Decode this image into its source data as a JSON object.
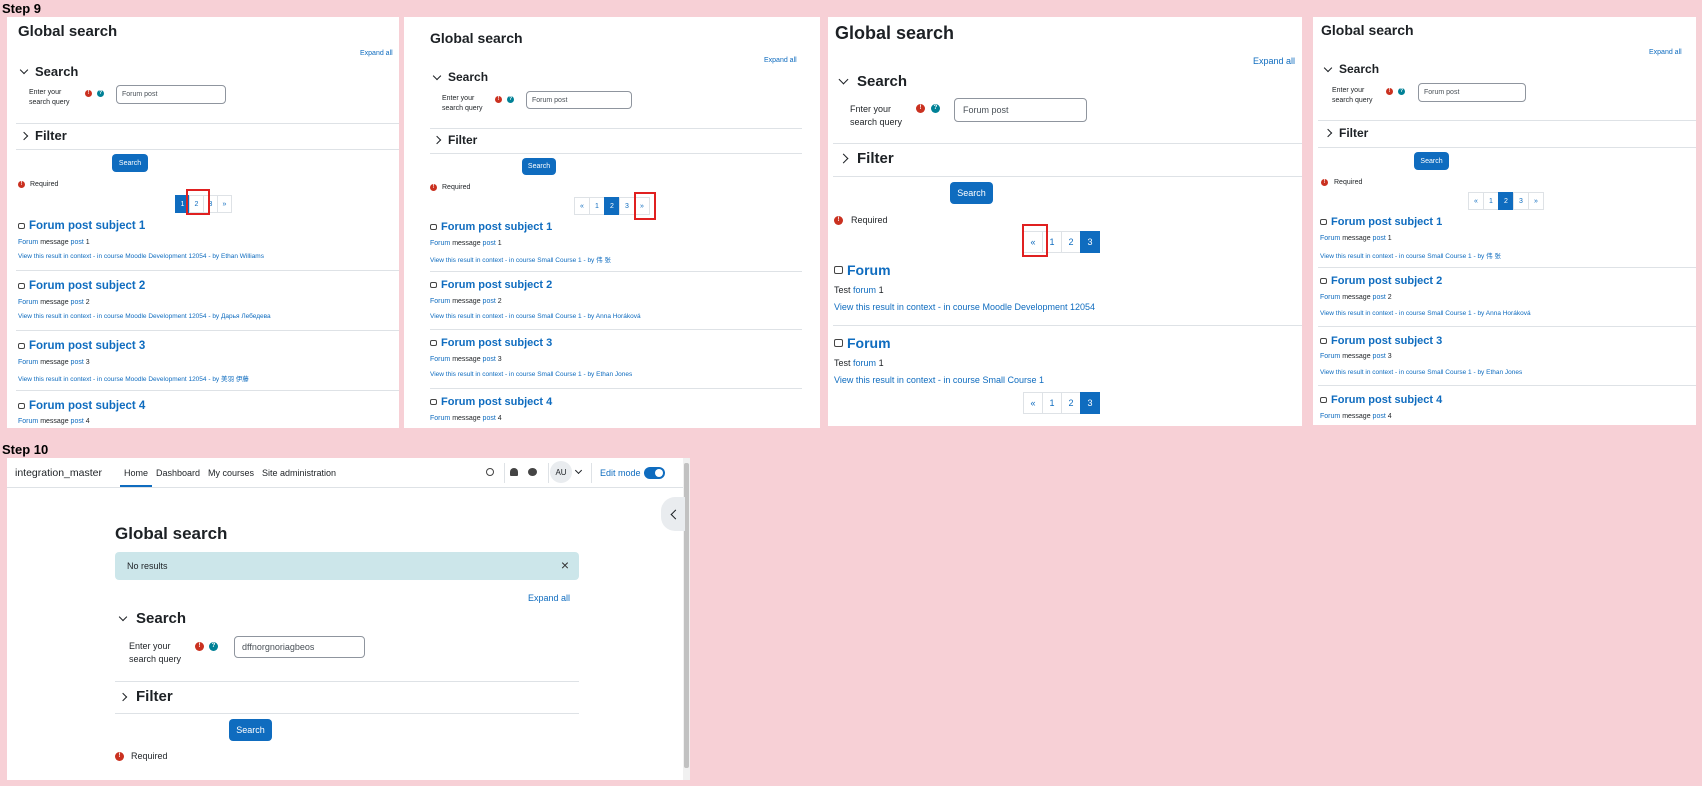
{
  "steps": {
    "step9": "Step 9",
    "step10": "Step 10"
  },
  "common": {
    "title": "Global search",
    "expand_all": "Expand all",
    "search_section": "Search",
    "filter_section": "Filter",
    "query_label_1": "Enter your",
    "query_label_2": "search query",
    "query_value": "Forum post",
    "search_button": "Search",
    "required": "Required",
    "req_icon": "!",
    "help_icon": "?",
    "prev": "«",
    "next": "»",
    "p1": "1",
    "p2": "2",
    "p3": "3",
    "forum_word": "Forum",
    "message_word": "message",
    "post_word": "post",
    "view_ctx": "View this result in context",
    "in_course": "- in course"
  },
  "panel1": {
    "results": [
      {
        "title": "Forum post subject 1",
        "num": "1",
        "course": "Moodle Development 12054",
        "by": "- by Ethan Williams"
      },
      {
        "title": "Forum post subject 2",
        "num": "2",
        "course": "Moodle Development 12054",
        "by": "- by Дарья Лебедева"
      },
      {
        "title": "Forum post subject 3",
        "num": "3",
        "course": "Moodle Development 12054",
        "by": "- by 美羽 伊藤"
      },
      {
        "title": "Forum post subject 4",
        "num": "4"
      }
    ]
  },
  "panel2": {
    "results": [
      {
        "title": "Forum post subject 1",
        "num": "1",
        "course": "Small Course 1",
        "by": "- by 伟 张"
      },
      {
        "title": "Forum post subject 2",
        "num": "2",
        "course": "Small Course 1",
        "by": "- by Anna Horáková"
      },
      {
        "title": "Forum post subject 3",
        "num": "3",
        "course": "Small Course 1",
        "by": "- by Ethan Jones"
      },
      {
        "title": "Forum post subject 4",
        "num": "4"
      }
    ]
  },
  "panel3": {
    "filter_label": "Fnter your",
    "results": [
      {
        "title": "Forum",
        "test": "Test",
        "forum": "forum",
        "num": "1",
        "course": "Moodle Development 12054"
      },
      {
        "title": "Forum",
        "test": "Test",
        "forum": "forum",
        "num": "1",
        "course": "Small Course 1"
      }
    ]
  },
  "panel4": {
    "results": [
      {
        "title": "Forum post subject 1",
        "num": "1",
        "course": "Small Course 1",
        "by": "- by 伟 张"
      },
      {
        "title": "Forum post subject 2",
        "num": "2",
        "course": "Small Course 1",
        "by": "- by Anna Horáková"
      },
      {
        "title": "Forum post subject 3",
        "num": "3",
        "course": "Small Course 1",
        "by": "- by Ethan Jones"
      },
      {
        "title": "Forum post subject 4",
        "num": "4"
      }
    ]
  },
  "step10": {
    "site_name": "integration_master",
    "nav": [
      "Home",
      "Dashboard",
      "My courses",
      "Site administration"
    ],
    "avatar": "AU",
    "edit_mode": "Edit mode",
    "alert": "No results",
    "alert_close": "×",
    "query_value": "dffnorgnoriagbeos"
  }
}
